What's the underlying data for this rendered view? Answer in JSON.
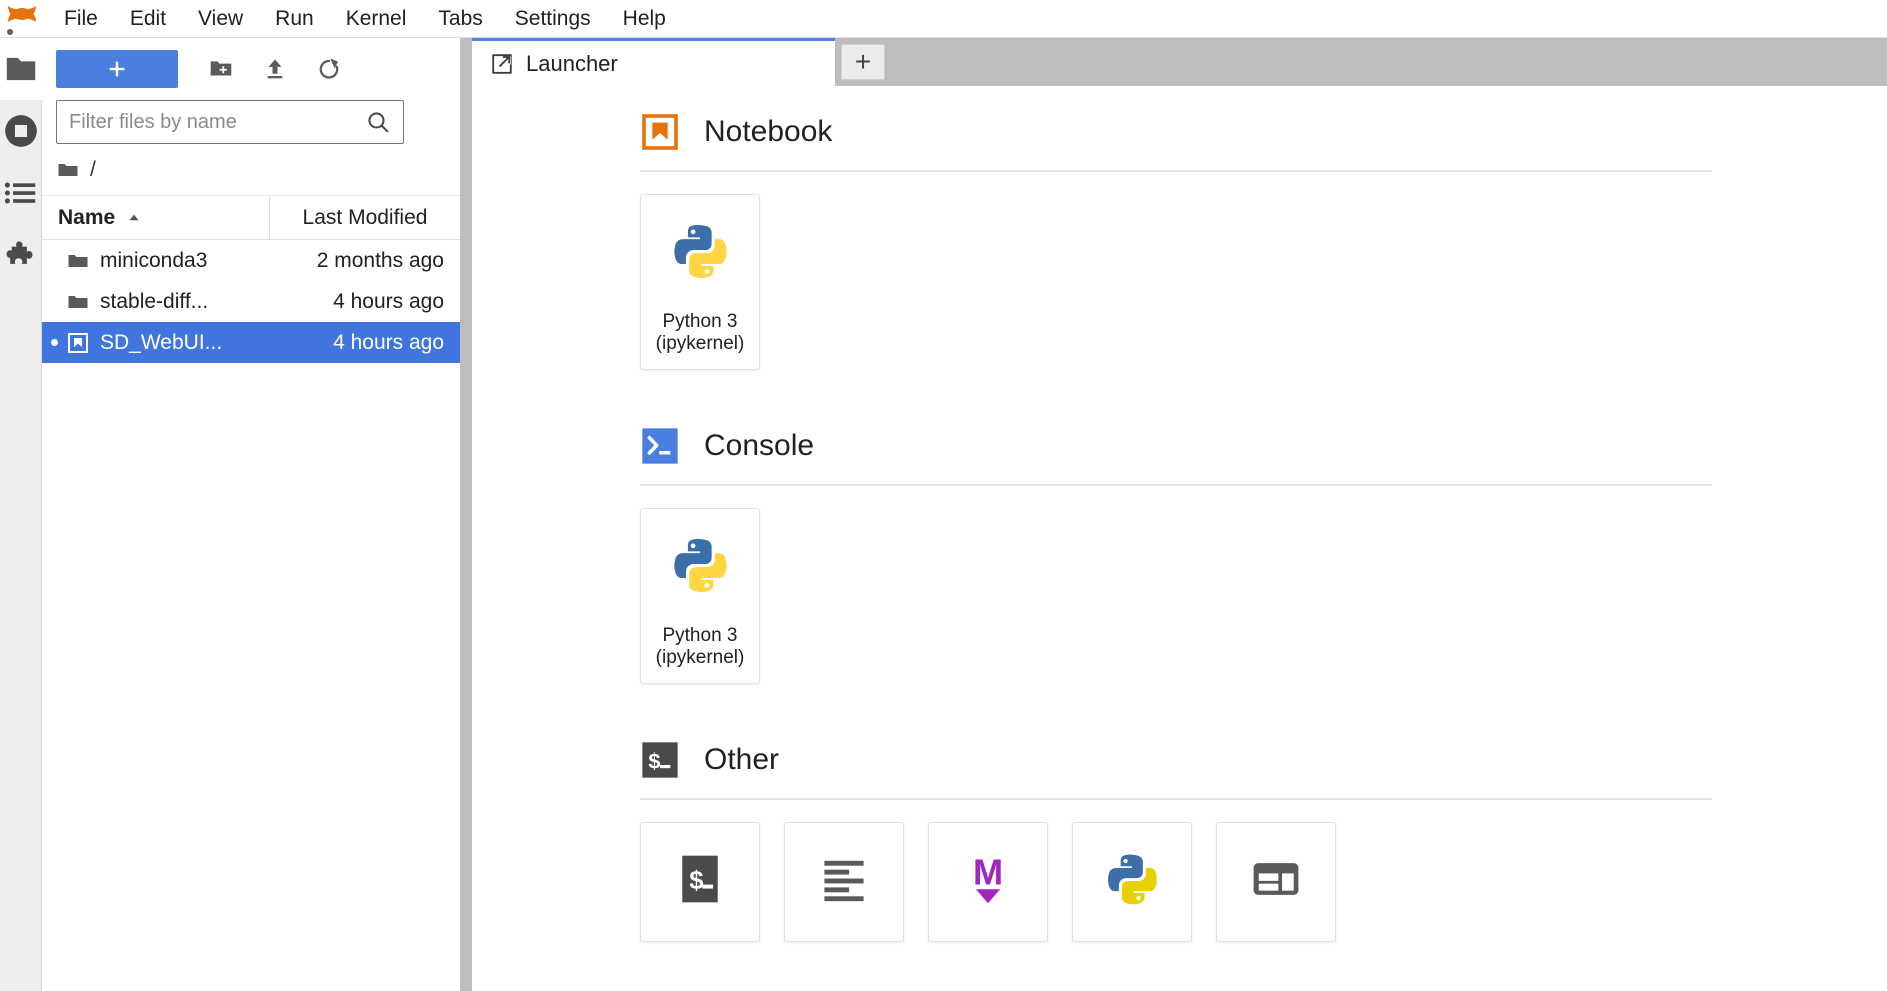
{
  "app": {
    "name": "JupyterLab",
    "logo_icon": "jupyter-logo"
  },
  "menubar": {
    "items": [
      {
        "label": "File"
      },
      {
        "label": "Edit"
      },
      {
        "label": "View"
      },
      {
        "label": "Run"
      },
      {
        "label": "Kernel"
      },
      {
        "label": "Tabs"
      },
      {
        "label": "Settings"
      },
      {
        "label": "Help"
      }
    ]
  },
  "activitybar": {
    "items": [
      {
        "name": "file-browser",
        "icon": "folder-icon",
        "active": true
      },
      {
        "name": "running-terminals-and-kernels",
        "icon": "running-stop-icon",
        "active": false
      },
      {
        "name": "table-of-contents",
        "icon": "list-icon",
        "active": false
      },
      {
        "name": "extension-manager",
        "icon": "puzzle-icon",
        "active": false
      }
    ]
  },
  "filebrowser": {
    "toolbar": {
      "new_launcher_label": "+",
      "new_launcher_icon": "plus-icon",
      "new_folder_icon": "new-folder-icon",
      "upload_icon": "upload-icon",
      "refresh_icon": "refresh-icon"
    },
    "filter": {
      "placeholder": "Filter files by name",
      "value": "",
      "icon": "search-icon"
    },
    "breadcrumb": {
      "home_icon": "folder-icon",
      "path": "/"
    },
    "columns": {
      "name": "Name",
      "last_modified": "Last Modified",
      "sort_indicator": "sort-ascending-icon"
    },
    "rows": [
      {
        "name": "miniconda3",
        "modified": "2 months ago",
        "icon": "folder-icon",
        "selected": false,
        "running": false
      },
      {
        "name": "stable-diff...",
        "modified": "4 hours ago",
        "icon": "folder-icon",
        "selected": false,
        "running": false
      },
      {
        "name": "SD_WebUI...",
        "modified": "4 hours ago",
        "icon": "notebook-icon",
        "selected": true,
        "running": true
      }
    ]
  },
  "main": {
    "tabs": [
      {
        "label": "Launcher",
        "icon": "launcher-icon",
        "active": true
      }
    ],
    "new_tab_label": "+"
  },
  "launcher": {
    "sections": [
      {
        "title": "Notebook",
        "icon": "notebook-icon",
        "cards": [
          {
            "label": "Python 3\n(ipykernel)",
            "line1": "Python 3",
            "line2": "(ipykernel)",
            "icon": "python-logo-icon"
          }
        ]
      },
      {
        "title": "Console",
        "icon": "console-icon",
        "cards": [
          {
            "label": "Python 3\n(ipykernel)",
            "line1": "Python 3",
            "line2": "(ipykernel)",
            "icon": "python-logo-icon"
          }
        ]
      },
      {
        "title": "Other",
        "icon": "terminal-icon",
        "cards": [
          {
            "label": "Terminal",
            "icon": "terminal-icon"
          },
          {
            "label": "Text File",
            "icon": "text-file-icon"
          },
          {
            "label": "Markdown File",
            "icon": "markdown-icon"
          },
          {
            "label": "Python File",
            "icon": "python-logo-icon"
          },
          {
            "label": "Show Contextual Help",
            "icon": "contextual-help-icon"
          }
        ]
      }
    ]
  },
  "colors": {
    "accent_blue": "#4A7FE0",
    "selection_blue": "#4175DE",
    "notebook_orange": "#E8730C",
    "console_blue": "#4A7FE0",
    "terminal_gray": "#4A4A4A",
    "markdown_purple": "#A026C0",
    "python_blue": "#3C6FA8",
    "python_yellow": "#FFD543",
    "tabbar_gray": "#bdbdbd",
    "activitybar_gray": "#eeeeee"
  }
}
